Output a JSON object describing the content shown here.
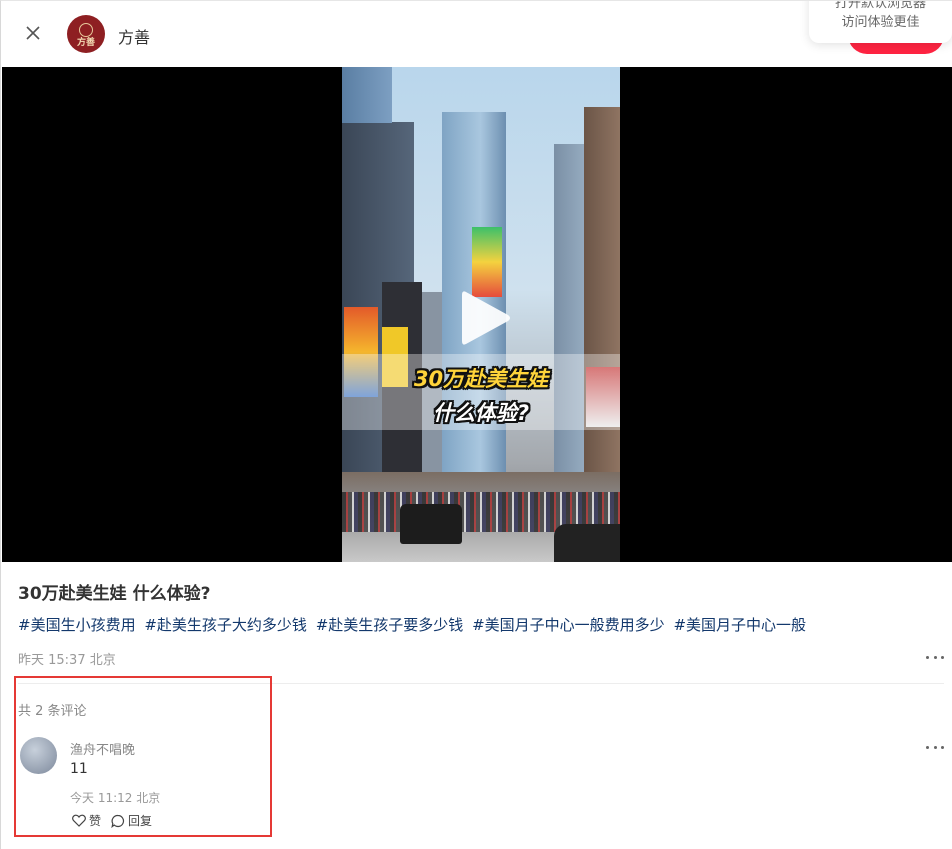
{
  "header": {
    "author_name": "方善",
    "logo_text": "方善",
    "hint_lines": [
      "打开默认浏览器",
      "访问体验更佳"
    ],
    "icons": {
      "close": "close-icon",
      "avatar": "brand-logo"
    }
  },
  "video": {
    "caption_line_1": "30万赴美生娃",
    "caption_line_2": "什么体验?",
    "icons": {
      "play": "play-icon"
    }
  },
  "note": {
    "title": "30万赴美生娃 什么体验?",
    "tags": [
      "#美国生小孩费用",
      "#赴美生孩子大约多少钱",
      "#赴美生孩子要多少钱",
      "#美国月子中心一般费用多少",
      "#美国月子中心一般"
    ],
    "date": "昨天 15:37 北京"
  },
  "comments": {
    "count_label": "共 2 条评论",
    "items": [
      {
        "author": "渔舟不唱晚",
        "text": "11",
        "date": "今天 11:12 北京",
        "like_label": "赞",
        "reply_label": "回复"
      }
    ]
  },
  "colors": {
    "accent": "#ff2442",
    "tag": "#13386c",
    "highlight": "#e53935",
    "brand": "#8e1f22"
  }
}
